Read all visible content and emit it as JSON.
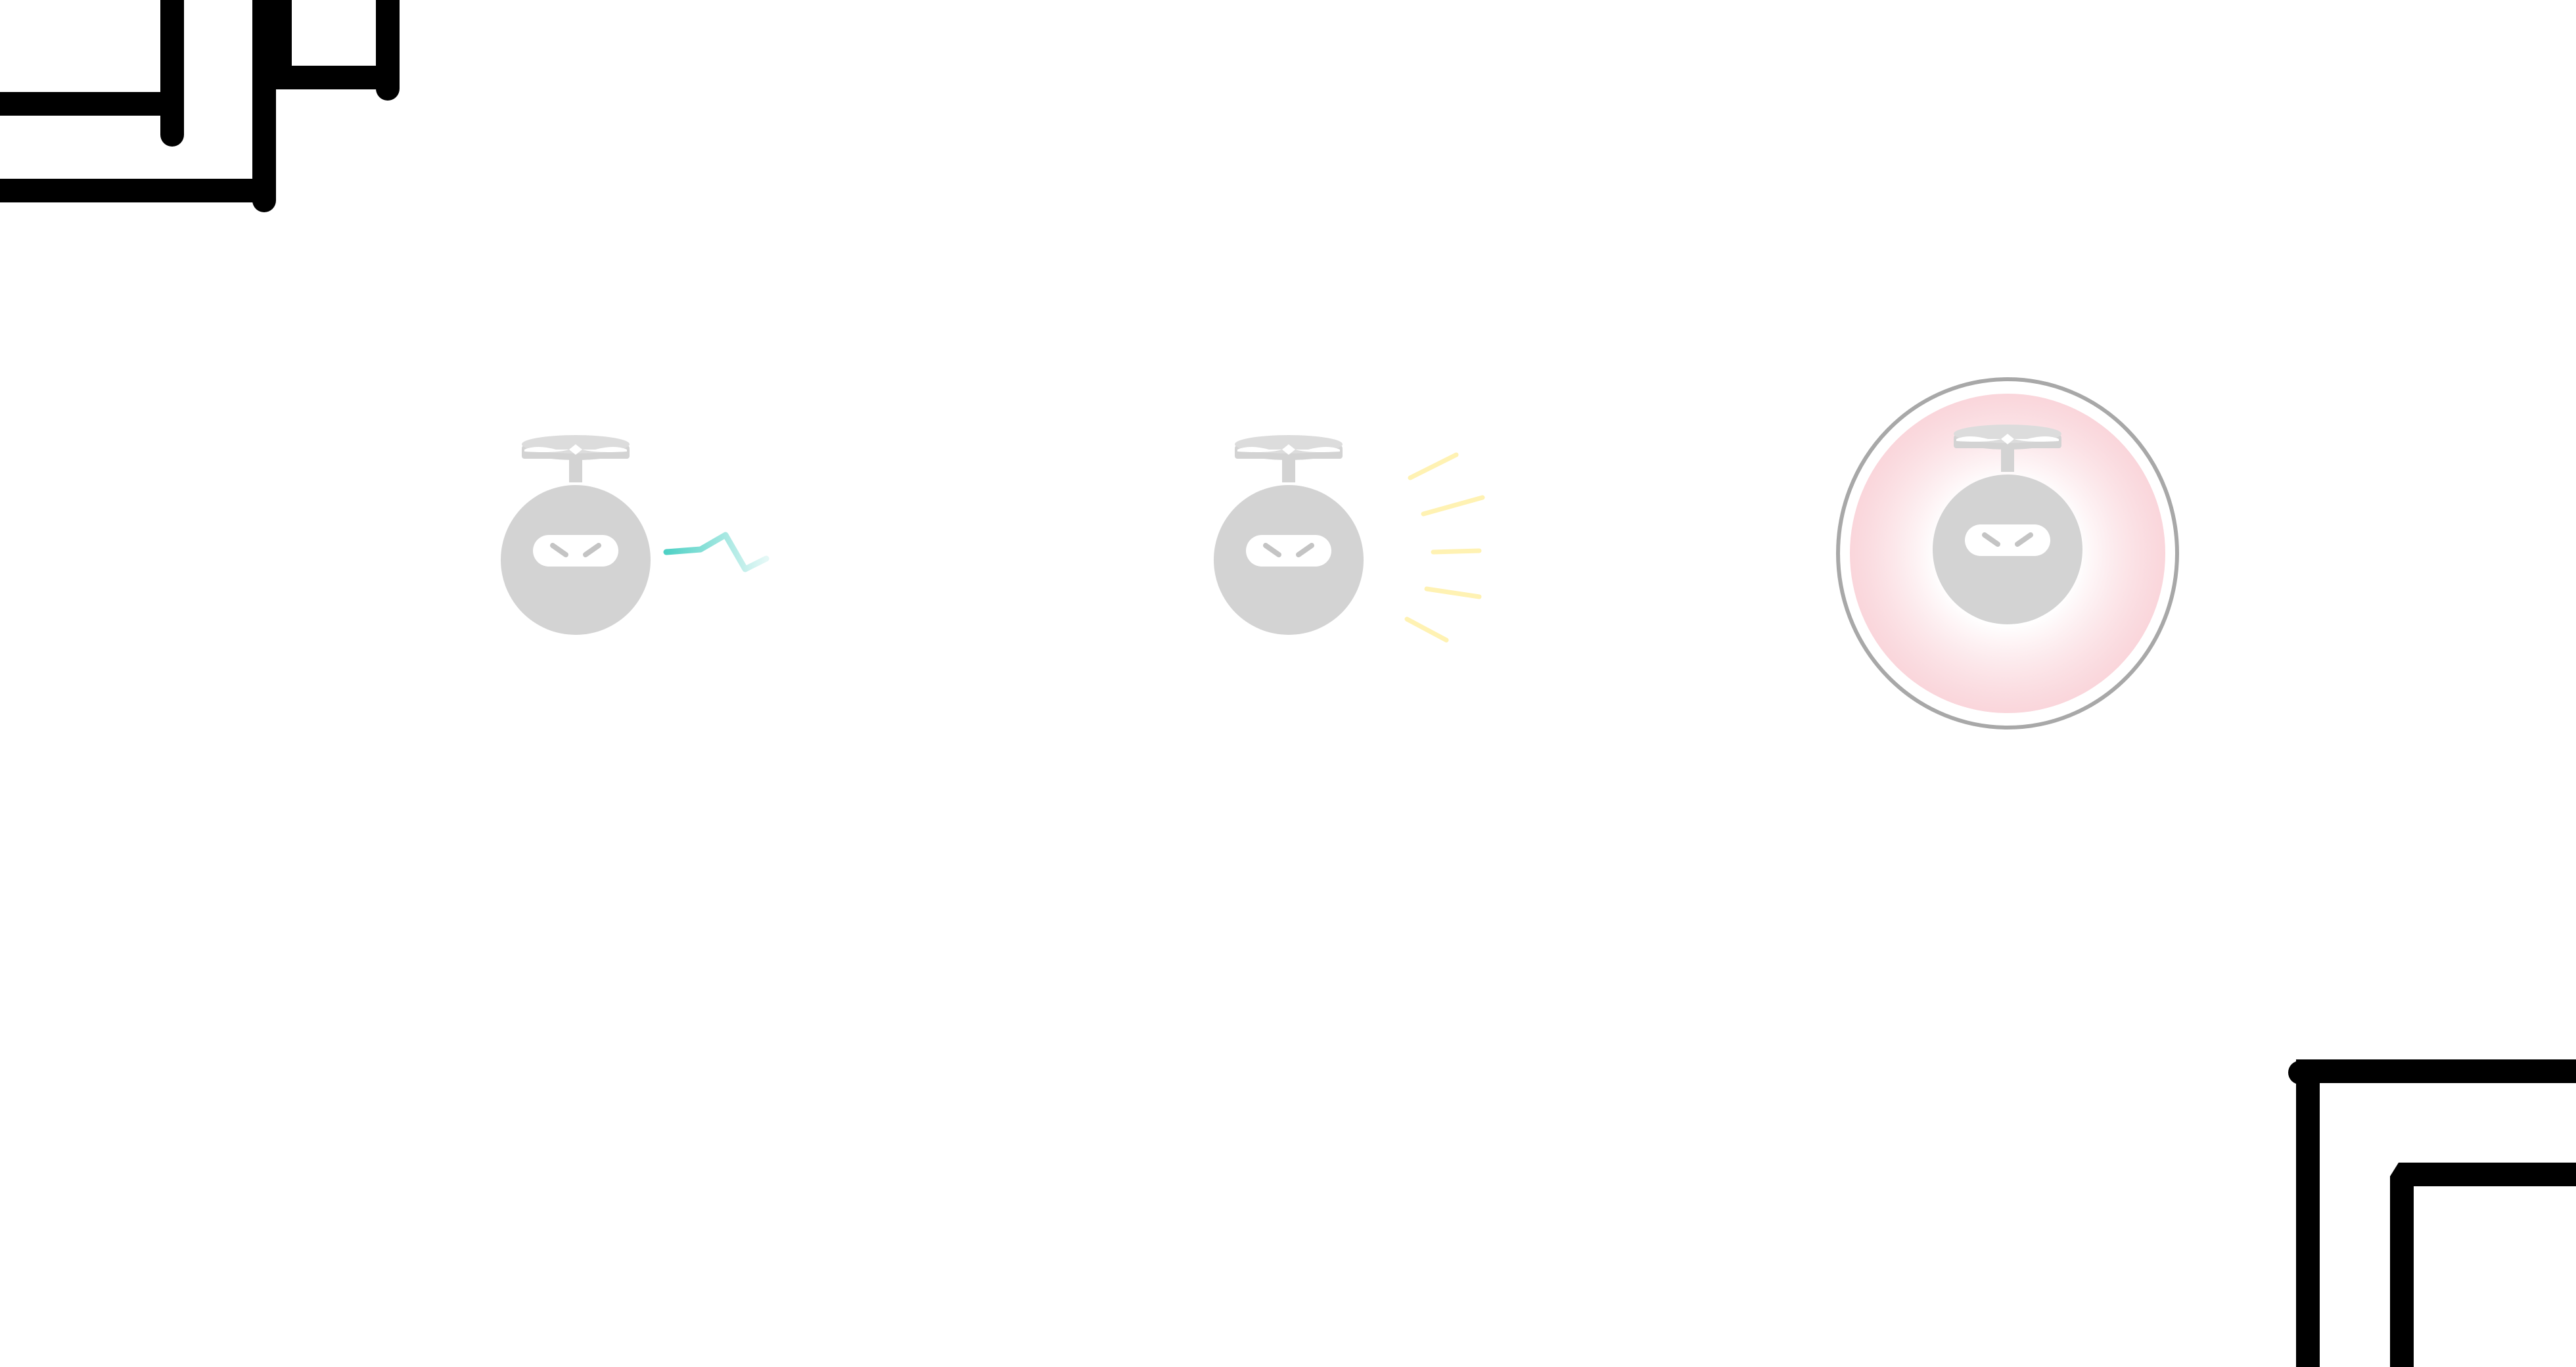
{
  "scene": {
    "background_color": "#ffffff",
    "wall_color": "#000000"
  },
  "robots": [
    {
      "id": "robot-1",
      "body_color": "#d3d3d3",
      "effect": "electric-spark",
      "effect_color": "#4fd1c5"
    },
    {
      "id": "robot-2",
      "body_color": "#d3d3d3",
      "effect": "light-rays",
      "effect_color": "#fff2b3"
    },
    {
      "id": "robot-3",
      "body_color": "#d3d3d3",
      "effect": "shield-bubble",
      "effect_color": "#f8c8cf",
      "shield_ring_color": "#a8a8a8"
    }
  ]
}
